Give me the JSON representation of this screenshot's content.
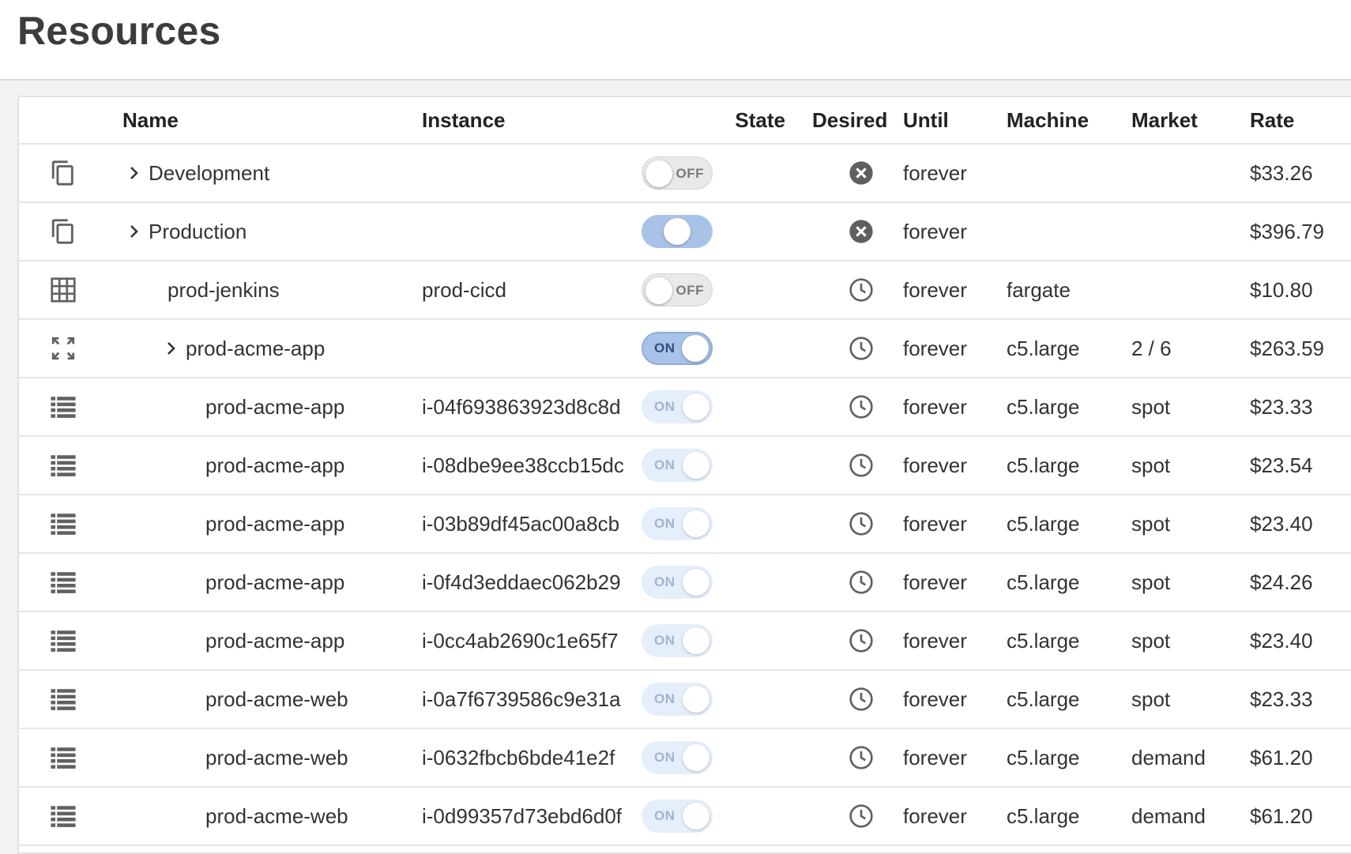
{
  "page": {
    "title": "Resources"
  },
  "columns": {
    "name": "Name",
    "instance": "Instance",
    "state": "State",
    "desired": "Desired",
    "until": "Until",
    "machine": "Machine",
    "market": "Market",
    "rate": "Rate"
  },
  "icons": {
    "copy": "copy-icon",
    "grid": "grid-icon",
    "expand": "fullscreen-icon",
    "list": "list-icon",
    "cancel": "cancel-circle-icon",
    "clock": "clock-icon",
    "chevron": "chevron-right-icon"
  },
  "colors": {
    "toggle_on": "#a9c3e8",
    "toggle_on_border": "#8eadda",
    "toggle_disabled": "#e5eefb",
    "toggle_off": "#e9e9e9",
    "icon": "#616161"
  },
  "rows": [
    {
      "icon": "copy",
      "indent": 0,
      "expandable": true,
      "name": "Development",
      "instance": "",
      "state": "off",
      "state_label": "OFF",
      "desired": "cancel",
      "until": "forever",
      "machine": "",
      "market": "",
      "rate": "$33.26"
    },
    {
      "icon": "copy",
      "indent": 0,
      "expandable": true,
      "name": "Production",
      "instance": "",
      "state": "mid",
      "state_label": "",
      "desired": "cancel",
      "until": "forever",
      "machine": "",
      "market": "",
      "rate": "$396.79"
    },
    {
      "icon": "grid",
      "indent": 1,
      "expandable": false,
      "name": "prod-jenkins",
      "instance": "prod-cicd",
      "state": "off",
      "state_label": "OFF",
      "desired": "clock",
      "until": "forever",
      "machine": "fargate",
      "market": "",
      "rate": "$10.80"
    },
    {
      "icon": "expand",
      "indent": 1,
      "expandable": true,
      "name": "prod-acme-app",
      "instance": "",
      "state": "on",
      "state_label": "ON",
      "desired": "clock",
      "until": "forever",
      "machine": "c5.large",
      "market": "2 / 6",
      "rate": "$263.59"
    },
    {
      "icon": "list",
      "indent": 2,
      "expandable": false,
      "name": "prod-acme-app",
      "instance": "i-04f693863923d8c8d",
      "state": "dim",
      "state_label": "ON",
      "desired": "clock",
      "until": "forever",
      "machine": "c5.large",
      "market": "spot",
      "rate": "$23.33"
    },
    {
      "icon": "list",
      "indent": 2,
      "expandable": false,
      "name": "prod-acme-app",
      "instance": "i-08dbe9ee38ccb15dc",
      "state": "dim",
      "state_label": "ON",
      "desired": "clock",
      "until": "forever",
      "machine": "c5.large",
      "market": "spot",
      "rate": "$23.54"
    },
    {
      "icon": "list",
      "indent": 2,
      "expandable": false,
      "name": "prod-acme-app",
      "instance": "i-03b89df45ac00a8cb",
      "state": "dim",
      "state_label": "ON",
      "desired": "clock",
      "until": "forever",
      "machine": "c5.large",
      "market": "spot",
      "rate": "$23.40"
    },
    {
      "icon": "list",
      "indent": 2,
      "expandable": false,
      "name": "prod-acme-app",
      "instance": "i-0f4d3eddaec062b29",
      "state": "dim",
      "state_label": "ON",
      "desired": "clock",
      "until": "forever",
      "machine": "c5.large",
      "market": "spot",
      "rate": "$24.26"
    },
    {
      "icon": "list",
      "indent": 2,
      "expandable": false,
      "name": "prod-acme-app",
      "instance": "i-0cc4ab2690c1e65f7",
      "state": "dim",
      "state_label": "ON",
      "desired": "clock",
      "until": "forever",
      "machine": "c5.large",
      "market": "spot",
      "rate": "$23.40"
    },
    {
      "icon": "list",
      "indent": 2,
      "expandable": false,
      "name": "prod-acme-web",
      "instance": "i-0a7f6739586c9e31a",
      "state": "dim",
      "state_label": "ON",
      "desired": "clock",
      "until": "forever",
      "machine": "c5.large",
      "market": "spot",
      "rate": "$23.33"
    },
    {
      "icon": "list",
      "indent": 2,
      "expandable": false,
      "name": "prod-acme-web",
      "instance": "i-0632fbcb6bde41e2f",
      "state": "dim",
      "state_label": "ON",
      "desired": "clock",
      "until": "forever",
      "machine": "c5.large",
      "market": "demand",
      "rate": "$61.20"
    },
    {
      "icon": "list",
      "indent": 2,
      "expandable": false,
      "name": "prod-acme-web",
      "instance": "i-0d99357d73ebd6d0f",
      "state": "dim",
      "state_label": "ON",
      "desired": "clock",
      "until": "forever",
      "machine": "c5.large",
      "market": "demand",
      "rate": "$61.20"
    }
  ]
}
